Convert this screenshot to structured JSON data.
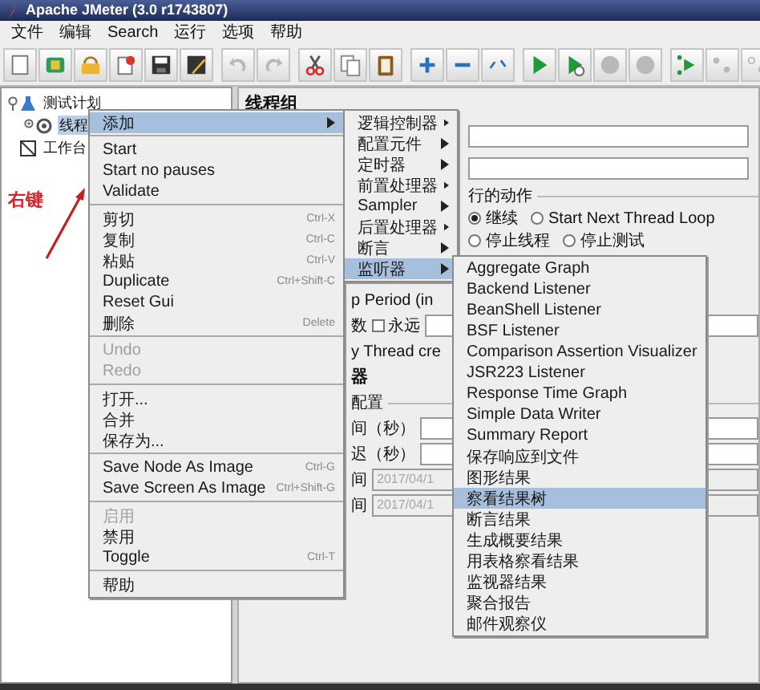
{
  "window": {
    "title": "Apache JMeter (3.0 r1743807)"
  },
  "menu_bar": [
    "文件",
    "编辑",
    "Search",
    "运行",
    "选项",
    "帮助"
  ],
  "toolbar": [
    [
      {
        "disabled": false
      },
      {
        "disabled": false
      },
      {
        "disabled": false
      },
      {
        "disabled": false
      },
      {
        "disabled": false
      },
      {
        "disabled": false
      }
    ],
    [
      {
        "disabled": true
      },
      {
        "disabled": true
      }
    ],
    [
      {
        "disabled": false
      },
      {
        "disabled": false
      },
      {
        "disabled": false
      }
    ],
    [
      {
        "disabled": false
      },
      {
        "disabled": false
      },
      {
        "disabled": false
      }
    ],
    [
      {
        "disabled": false
      },
      {
        "disabled": false
      },
      {
        "disabled": true
      },
      {
        "disabled": true
      }
    ],
    [
      {
        "disabled": false
      },
      {
        "disabled": true
      },
      {
        "disabled": true
      }
    ]
  ],
  "tree": [
    {
      "label": "测试计划",
      "kind": "plan",
      "selected": false,
      "expanded": true,
      "children": [
        {
          "label": "线程",
          "kind": "group",
          "selected": true,
          "expanded": false
        }
      ]
    },
    {
      "label": "工作台",
      "kind": "workbench",
      "selected": false
    }
  ],
  "annotation": {
    "label": "右键"
  },
  "panel": {
    "title": "线程组",
    "error_action": {
      "label": "行的动作",
      "options": [
        {
          "label": "继续",
          "selected": true
        },
        {
          "label": "Start Next Thread Loop",
          "selected": false
        },
        {
          "label": "停止线程",
          "selected": false
        },
        {
          "label": "停止测试",
          "selected": false
        }
      ]
    },
    "partial_rows": [
      {
        "kind": "text",
        "label": "p Period (in"
      },
      {
        "kind": "checkbox",
        "label": "数",
        "option": "永远",
        "checked": false
      },
      {
        "kind": "text",
        "label": "y Thread cre"
      },
      {
        "kind": "heading",
        "label": "器"
      },
      {
        "kind": "group",
        "label": "配置"
      },
      {
        "kind": "input",
        "label": "间（秒）",
        "disabled": false
      },
      {
        "kind": "input",
        "label": "迟（秒）",
        "disabled": false
      },
      {
        "kind": "input",
        "label": "间",
        "value": "2017/04/1",
        "disabled": true
      },
      {
        "kind": "input",
        "label": "间",
        "value": "2017/04/1",
        "disabled": true
      }
    ]
  },
  "menus": [
    {
      "groups": [
        [
          {
            "label": "添加",
            "selected": true,
            "disabled": false,
            "submenu": true
          }
        ],
        [
          {
            "label": "Start",
            "selected": false,
            "disabled": false,
            "submenu": false
          },
          {
            "label": "Start no pauses",
            "selected": false,
            "disabled": false,
            "submenu": false
          },
          {
            "label": "Validate",
            "selected": false,
            "disabled": false,
            "submenu": false
          }
        ],
        [
          {
            "label": "剪切",
            "shortcut": "Ctrl-X",
            "selected": false,
            "disabled": false,
            "submenu": false
          },
          {
            "label": "复制",
            "shortcut": "Ctrl-C",
            "selected": false,
            "disabled": false,
            "submenu": false
          },
          {
            "label": "粘贴",
            "shortcut": "Ctrl-V",
            "selected": false,
            "disabled": false,
            "submenu": false
          },
          {
            "label": "Duplicate",
            "shortcut": "Ctrl+Shift-C",
            "selected": false,
            "disabled": false,
            "submenu": false
          },
          {
            "label": "Reset Gui",
            "selected": false,
            "disabled": false,
            "submenu": false
          },
          {
            "label": "删除",
            "shortcut": "Delete",
            "selected": false,
            "disabled": false,
            "submenu": false
          }
        ],
        [
          {
            "label": "Undo",
            "selected": false,
            "disabled": true,
            "submenu": false
          },
          {
            "label": "Redo",
            "selected": false,
            "disabled": true,
            "submenu": false
          }
        ],
        [
          {
            "label": "打开...",
            "selected": false,
            "disabled": false,
            "submenu": false
          },
          {
            "label": "合并",
            "selected": false,
            "disabled": false,
            "submenu": false
          },
          {
            "label": "保存为...",
            "selected": false,
            "disabled": false,
            "submenu": false
          }
        ],
        [
          {
            "label": "Save Node As Image",
            "shortcut": "Ctrl-G",
            "selected": false,
            "disabled": false,
            "submenu": false
          },
          {
            "label": "Save Screen As Image",
            "shortcut": "Ctrl+Shift-G",
            "selected": false,
            "disabled": false,
            "submenu": false
          }
        ],
        [
          {
            "label": "启用",
            "selected": false,
            "disabled": true,
            "submenu": false
          },
          {
            "label": "禁用",
            "selected": false,
            "disabled": false,
            "submenu": false
          },
          {
            "label": "Toggle",
            "shortcut": "Ctrl-T",
            "selected": false,
            "disabled": false,
            "submenu": false
          }
        ],
        [
          {
            "label": "帮助",
            "selected": false,
            "disabled": false,
            "submenu": false
          }
        ]
      ]
    },
    {
      "groups": [
        [
          {
            "label": "逻辑控制器",
            "selected": false,
            "submenu": true
          },
          {
            "label": "配置元件",
            "selected": false,
            "submenu": true
          },
          {
            "label": "定时器",
            "selected": false,
            "submenu": true
          },
          {
            "label": "前置处理器",
            "selected": false,
            "submenu": true
          },
          {
            "label": "Sampler",
            "selected": false,
            "submenu": true
          },
          {
            "label": "后置处理器",
            "selected": false,
            "submenu": true
          },
          {
            "label": "断言",
            "selected": false,
            "submenu": true
          },
          {
            "label": "监听器",
            "selected": true,
            "submenu": true
          }
        ]
      ]
    },
    {
      "groups": [
        [
          {
            "label": "Aggregate Graph",
            "selected": false
          },
          {
            "label": "Backend Listener",
            "selected": false
          },
          {
            "label": "BeanShell Listener",
            "selected": false
          },
          {
            "label": "BSF Listener",
            "selected": false
          },
          {
            "label": "Comparison Assertion Visualizer",
            "selected": false
          },
          {
            "label": "JSR223 Listener",
            "selected": false
          },
          {
            "label": "Response Time Graph",
            "selected": false
          },
          {
            "label": "Simple Data Writer",
            "selected": false
          },
          {
            "label": "Summary Report",
            "selected": false
          },
          {
            "label": "保存响应到文件",
            "selected": false
          },
          {
            "label": "图形结果",
            "selected": false
          },
          {
            "label": "察看结果树",
            "selected": true
          },
          {
            "label": "断言结果",
            "selected": false
          },
          {
            "label": "生成概要结果",
            "selected": false
          },
          {
            "label": "用表格察看结果",
            "selected": false
          },
          {
            "label": "监视器结果",
            "selected": false
          },
          {
            "label": "聚合报告",
            "selected": false
          },
          {
            "label": "邮件观察仪",
            "selected": false
          }
        ]
      ]
    }
  ]
}
